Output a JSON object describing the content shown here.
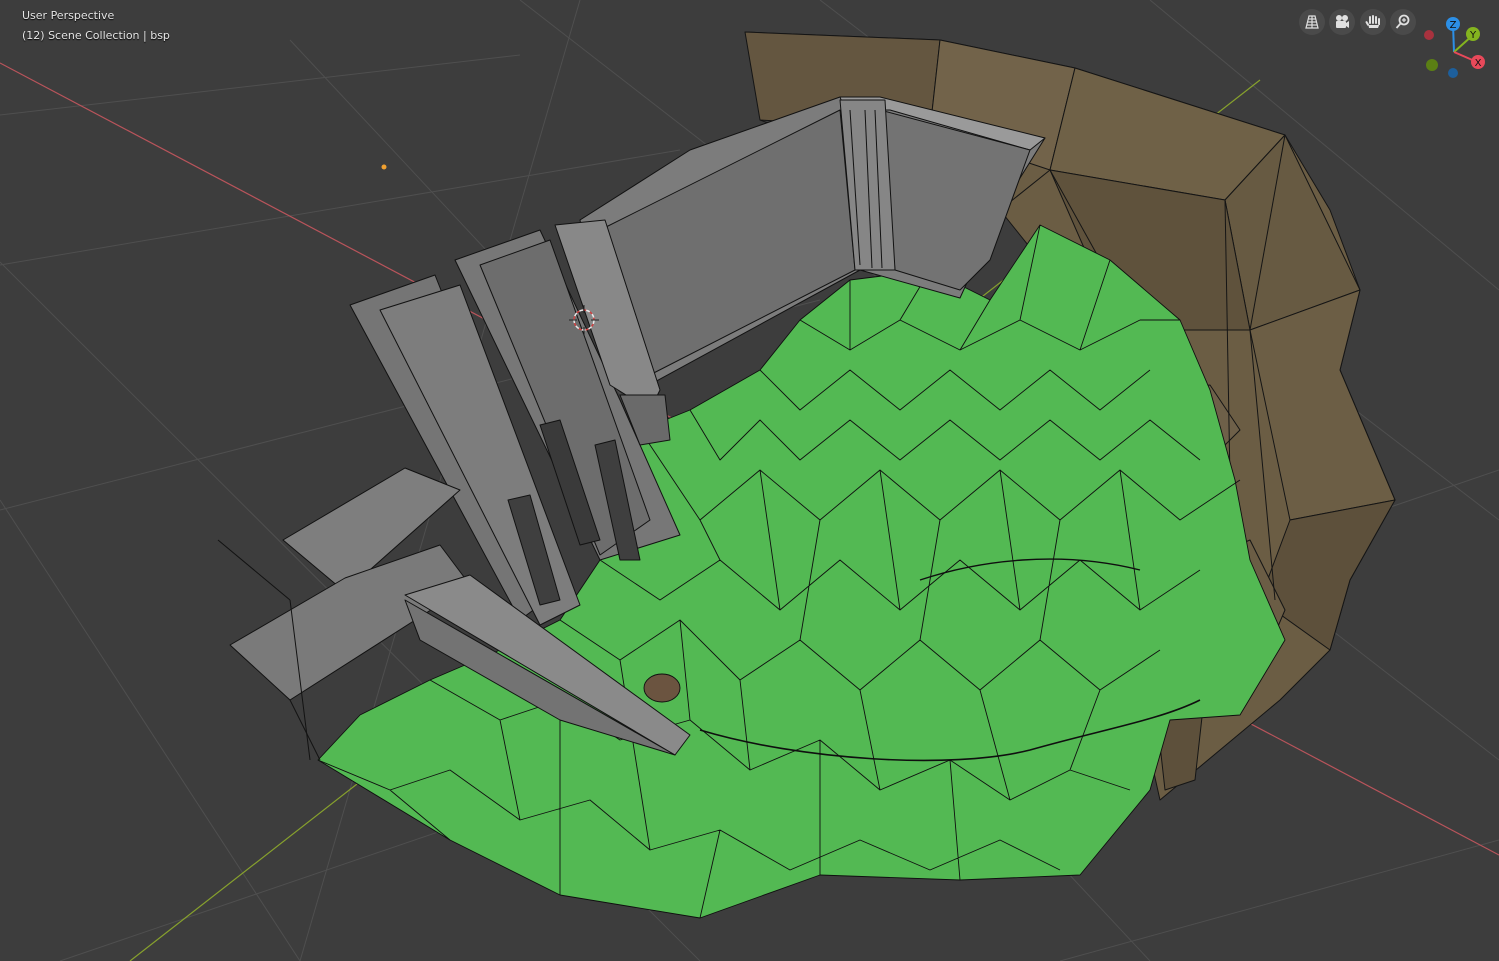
{
  "viewport": {
    "view_name": "User Perspective",
    "collection_info": "(12) Scene Collection | bsp"
  },
  "nav_tools": [
    {
      "name": "toggle-camera-view-grid-icon"
    },
    {
      "name": "camera-icon"
    },
    {
      "name": "hand-pan-icon"
    },
    {
      "name": "zoom-magnifier-icon"
    }
  ],
  "gizmo": {
    "z_label": "Z",
    "y_label": "Y",
    "x_label": "X",
    "colors": {
      "x": "#e8495a",
      "y": "#84b41f",
      "z": "#2c8fe6",
      "neg_x": "#a8323e",
      "neg_y": "#5b7f14",
      "neg_z": "#1d5f9c"
    }
  },
  "colors": {
    "background": "#3d3d3d",
    "grid": "#505050",
    "x_axis": "#c4565e",
    "y_axis": "#88a32c",
    "terrain": "#55b955",
    "rock": "#6e5f46",
    "wall": "#7f7f7f",
    "wireframe": "#111111"
  }
}
